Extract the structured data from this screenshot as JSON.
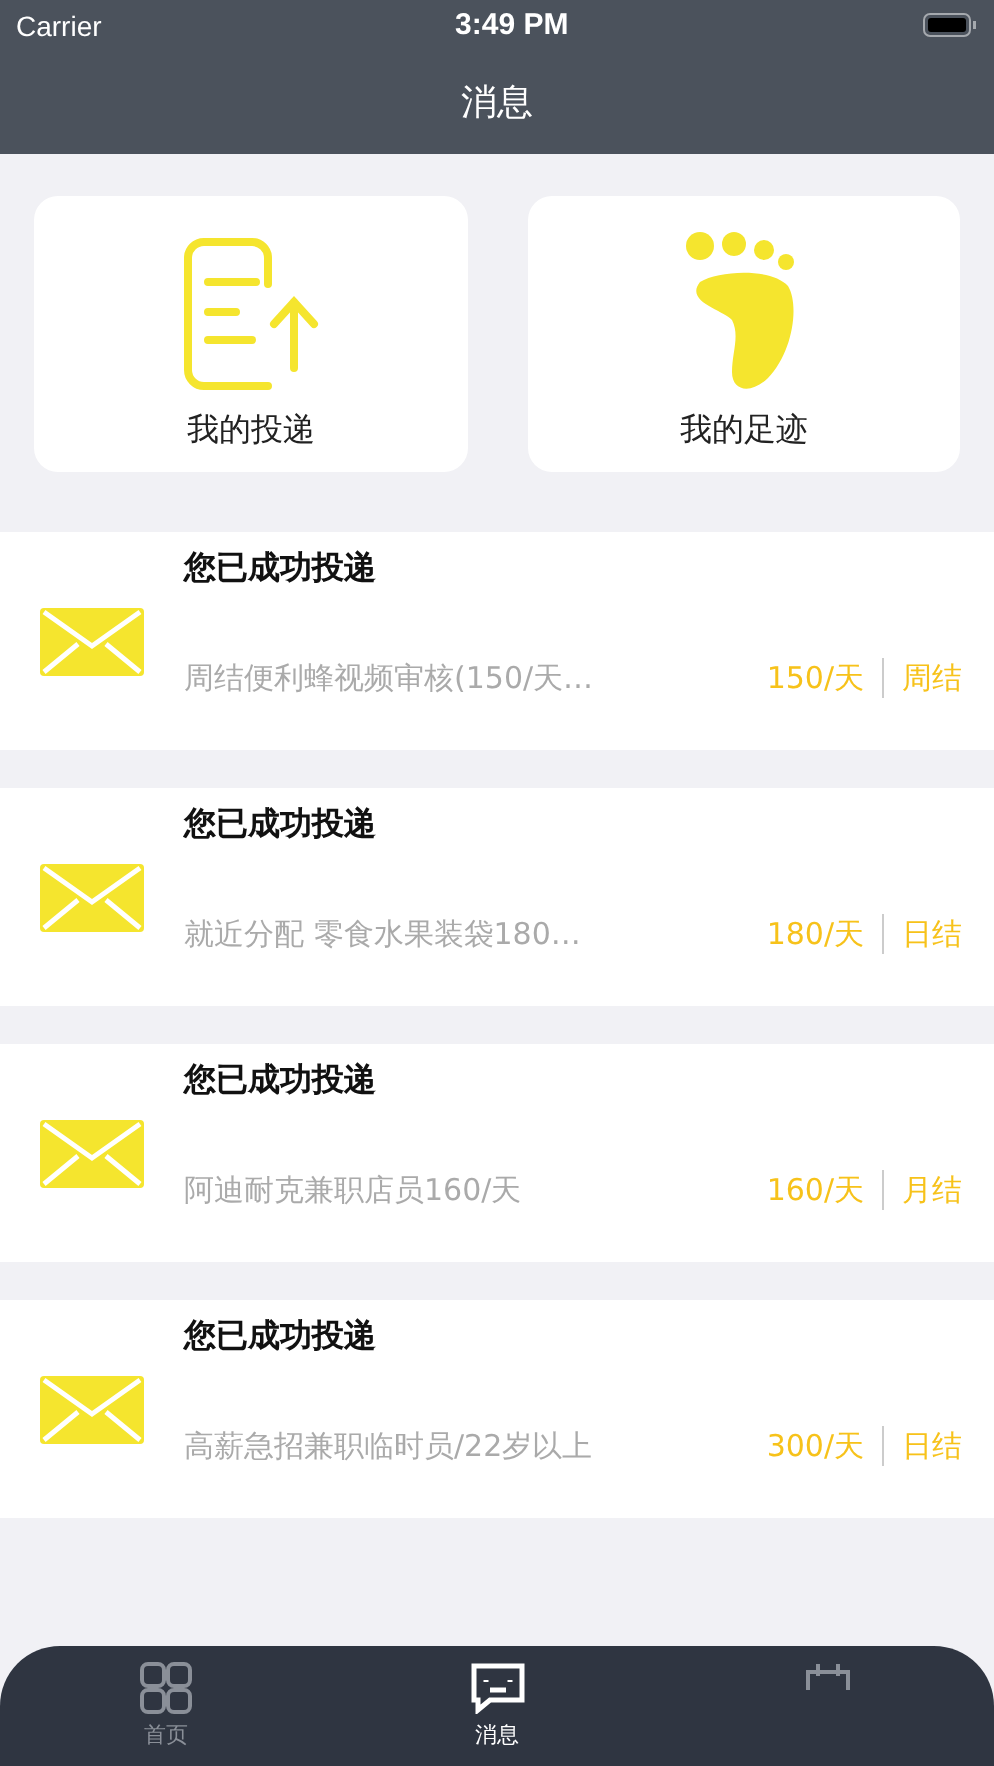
{
  "status_bar": {
    "carrier": "Carrier",
    "time": "3:49 PM"
  },
  "nav": {
    "title": "消息"
  },
  "shortcuts": [
    {
      "kind": "upload",
      "label": "我的投递"
    },
    {
      "kind": "foot",
      "label": "我的足迹"
    }
  ],
  "messages": [
    {
      "title": "您已成功投递",
      "job": "周结便利蜂视频审核(150/天…",
      "pay": "150/天",
      "settle": "周结"
    },
    {
      "title": "您已成功投递",
      "job": "就近分配 零食水果装袋180…",
      "pay": "180/天",
      "settle": "日结"
    },
    {
      "title": "您已成功投递",
      "job": "阿迪耐克兼职店员160/天",
      "pay": "160/天",
      "settle": "月结"
    },
    {
      "title": "您已成功投递",
      "job": "高薪急招兼职临时员/22岁以上",
      "pay": "300/天",
      "settle": "日结"
    }
  ],
  "tabs": [
    {
      "kind": "grid",
      "label": "首页",
      "selected": false
    },
    {
      "kind": "chat",
      "label": "消息",
      "selected": true
    },
    {
      "kind": "calendar",
      "selected": false
    }
  ]
}
